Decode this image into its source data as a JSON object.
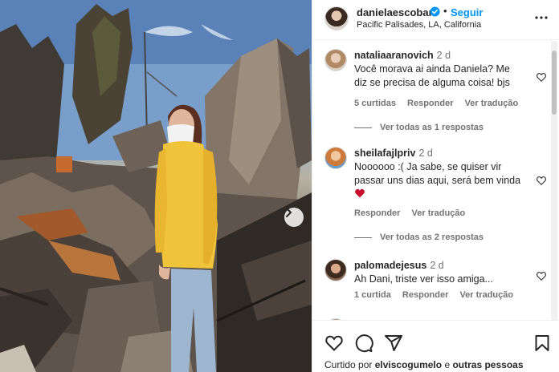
{
  "post": {
    "username": "danielaescobar",
    "follow_label": "Seguir",
    "separator": "•",
    "location": "Pacific Palisades, LA, California"
  },
  "comments": [
    {
      "user": "nataliaaranovich",
      "time": "2 d",
      "text": "Você morava ai ainda Daniela? Me diz se precisa de alguma coisa! bjs",
      "likes": "5 curtidas",
      "reply": "Responder",
      "translate": "Ver tradução",
      "view_replies": "Ver todas as 1 respostas"
    },
    {
      "user": "sheilafajlpriv",
      "time": "2 d",
      "text": "Noooooo :( Ja sabe, se quiser vir passar uns dias aqui, será bem vinda",
      "reply": "Responder",
      "translate": "Ver tradução",
      "view_replies": "Ver todas as 2 respostas"
    },
    {
      "user": "palomadejesus",
      "time": "2 d",
      "text": "Ah Dani, triste ver isso amiga...",
      "likes": "1 curtida",
      "reply": "Responder",
      "translate": "Ver tradução"
    }
  ],
  "liked_by": {
    "prefix": "Curtido por",
    "user": "elviscogumelo",
    "connector": "e",
    "others": "outras pessoas"
  },
  "colors": {
    "accent": "#0095f6",
    "heart_emoji": "#c8102e"
  },
  "icons": [
    "verified-badge-icon",
    "more-options-icon",
    "next-arrow-icon",
    "heart-icon",
    "comment-icon",
    "share-icon",
    "bookmark-icon"
  ]
}
